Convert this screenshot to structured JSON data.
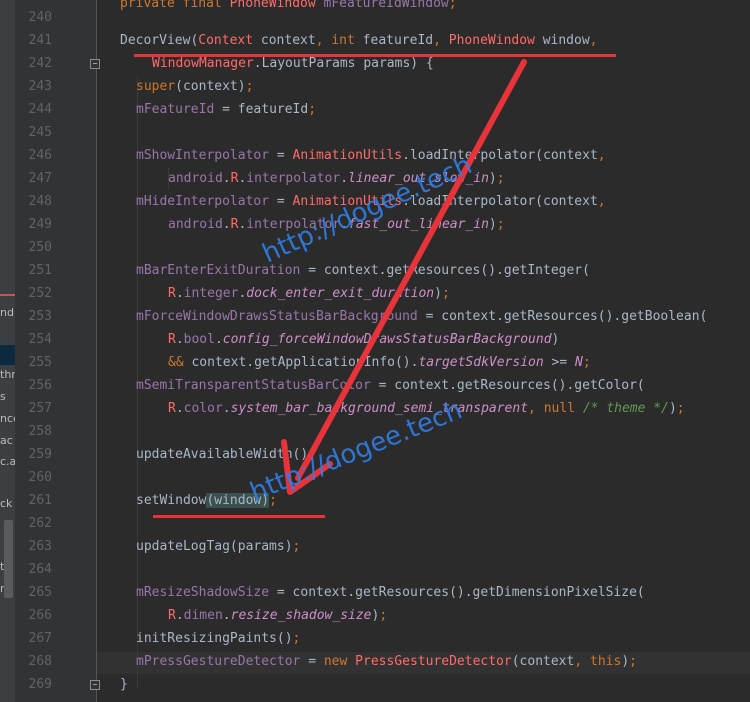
{
  "editor": {
    "lines": [
      {
        "n": "240",
        "text": "private final PhoneWindow mFeatureIdWindow;"
      },
      {
        "n": "241",
        "text": "DecorView(Context context, int featureId, PhoneWindow window,"
      },
      {
        "n": "242",
        "text": "WindowManager.LayoutParams params) {"
      },
      {
        "n": "243",
        "text": "super(context);"
      },
      {
        "n": "244",
        "text": "mFeatureId = featureId;"
      },
      {
        "n": "245",
        "text": ""
      },
      {
        "n": "246",
        "text": "mShowInterpolator = AnimationUtils.loadInterpolator(context,"
      },
      {
        "n": "247",
        "text": "android.R.interpolator.linear_out_slow_in);"
      },
      {
        "n": "248",
        "text": "mHideInterpolator = AnimationUtils.loadInterpolator(context,"
      },
      {
        "n": "249",
        "text": "android.R.interpolator.fast_out_linear_in);"
      },
      {
        "n": "250",
        "text": ""
      },
      {
        "n": "251",
        "text": "mBarEnterExitDuration = context.getResources().getInteger("
      },
      {
        "n": "252",
        "text": "R.integer.dock_enter_exit_duration);"
      },
      {
        "n": "253",
        "text": "mForceWindowDrawsStatusBarBackground = context.getResources().getBoolean("
      },
      {
        "n": "254",
        "text": "R.bool.config_forceWindowDrawsStatusBarBackground)"
      },
      {
        "n": "255",
        "text": "&& context.getApplicationInfo().targetSdkVersion >= N;"
      },
      {
        "n": "256",
        "text": "mSemiTransparentStatusBarColor = context.getResources().getColor("
      },
      {
        "n": "257",
        "text": "R.color.system_bar_background_semi_transparent, null /* theme */);"
      },
      {
        "n": "258",
        "text": ""
      },
      {
        "n": "259",
        "text": "updateAvailableWidth();"
      },
      {
        "n": "260",
        "text": ""
      },
      {
        "n": "261",
        "text": "setWindow(window);"
      },
      {
        "n": "262",
        "text": ""
      },
      {
        "n": "263",
        "text": "updateLogTag(params);"
      },
      {
        "n": "264",
        "text": ""
      },
      {
        "n": "265",
        "text": "mResizeShadowSize = context.getResources().getDimensionPixelSize("
      },
      {
        "n": "266",
        "text": "R.dimen.resize_shadow_size);"
      },
      {
        "n": "267",
        "text": "initResizingPaints();"
      },
      {
        "n": "268",
        "text": "mPressGestureDetector = new PressGestureDetector(context, this);"
      },
      {
        "n": "269",
        "text": "}"
      }
    ]
  },
  "left_panel": {
    "fragments": [
      "nd",
      "thn",
      "s",
      "nce",
      "ac",
      "c.a",
      "ck",
      "tH",
      "r"
    ]
  },
  "watermarks": {
    "first": "http://dogee.tech",
    "second": "http://dogee.tech"
  },
  "colors": {
    "annotation_red": "#e8333a",
    "watermark_blue": "#2f7fe8",
    "background": "#2b2b2b"
  }
}
